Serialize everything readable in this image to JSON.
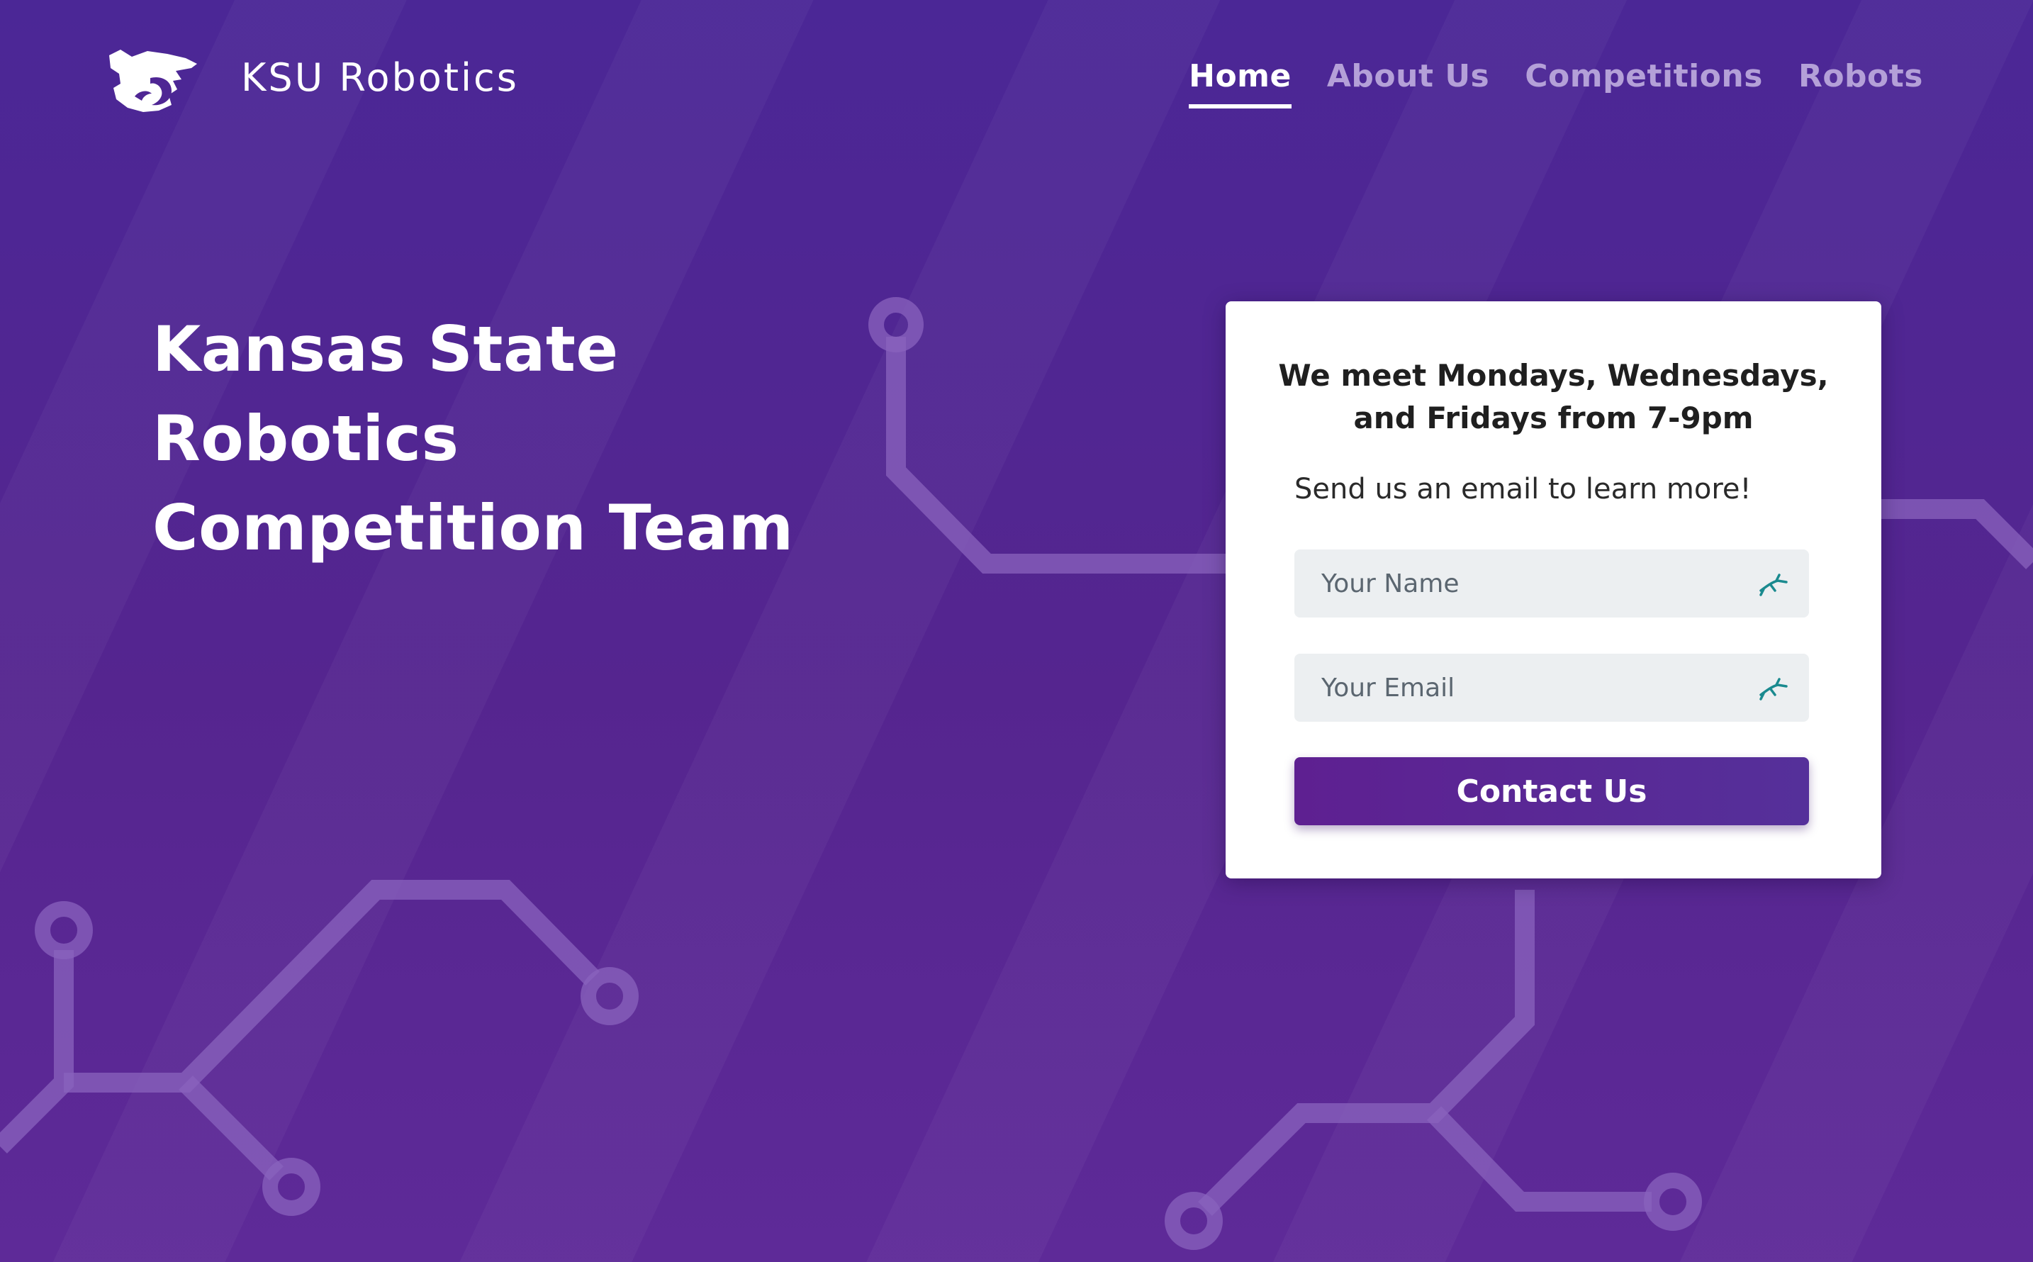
{
  "header": {
    "brand": "KSU Robotics",
    "logo_icon": "wildcat-logo-icon",
    "nav": [
      {
        "label": "Home",
        "active": true
      },
      {
        "label": "About Us",
        "active": false
      },
      {
        "label": "Competitions",
        "active": false
      },
      {
        "label": "Robots",
        "active": false
      }
    ]
  },
  "hero": {
    "title_line1": "Kansas State Robotics",
    "title_line2": "Competition Team"
  },
  "card": {
    "heading_line1": "We meet Mondays, Wednesdays,",
    "heading_line2": "and Fridays from 7-9pm",
    "subtext": "Send us an email to learn more!",
    "name_placeholder": "Your Name",
    "email_placeholder": "Your Email",
    "field_icon": "autofill-extension-icon",
    "button_label": "Contact Us"
  },
  "colors": {
    "background": "#4f2694",
    "circuit_lines": "#8a63bd",
    "button": "#5a2596",
    "card": "#ffffff",
    "field": "#eceff1",
    "field_icon": "#1a8a8f"
  }
}
